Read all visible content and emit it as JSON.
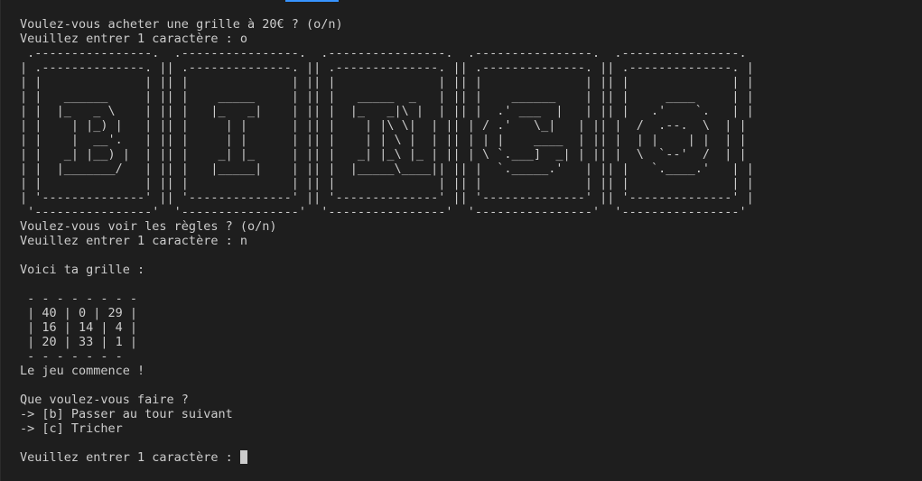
{
  "colors": {
    "background": "#1e1e1e",
    "text": "#cccccc",
    "accent": "#3794ff"
  },
  "lines": [
    "Voulez-vous acheter une grille à 20€ ? (o/n)",
    "Veuillez entrer 1 caractère : o",
    " .----------------.  .----------------.  .----------------.  .----------------.  .----------------.",
    "| .--------------. || .--------------. || .--------------. || .--------------. || .--------------. |",
    "| |              | || |              | || |              | || |              | || |              | |",
    "| |   ______     | || |    _____     | || |   _____  _   | || |    ______    | || |     ____     | |",
    "| |  |_   _ \\    | || |   |_   _|    | || |  |_   _|\\ |  | || |  .' ___  |   | || |   .'    `.   | |",
    "| |    | |_) |   | || |     | |      | || |    | |\\ \\|  | || | / .'   \\_|   | || |  /  .--.  \\  | |",
    "| |    |  __'.   | || |     | |      | || |    | | \\ |  | || | | |    ____  | || |  | |    | |  | |",
    "| |   _| |__) |  | || |    _| |_     | || |   _| |_\\ |_ | || | \\ `.___]  _| | || |  \\  `--'  /  | |",
    "| |  |_______/   | || |   |_____|    | || |  |_____\\____|| || |  `._____.'   | || |   `.____.'   | |",
    "| |              | || |              | || |              | || |              | || |              | |",
    "| '--------------' || '--------------' || '--------------' || '--------------' || '--------------' |",
    " '----------------'  '----------------'  '----------------'  '----------------'  '----------------'",
    "Voulez-vous voir les règles ? (o/n)",
    "Veuillez entrer 1 caractère : n",
    "",
    "Voici ta grille :",
    "",
    " - - - - - - - -",
    " | 40 | 0 | 29 |",
    " | 16 | 14 | 4 |",
    " | 20 | 33 | 1 |",
    " - - - - - - -",
    "Le jeu commence !",
    "",
    "Que voulez-vous faire ?",
    "-> [b] Passer au tour suivant",
    "-> [c] Tricher",
    ""
  ],
  "prompt": "Veuillez entrer 1 caractère : "
}
